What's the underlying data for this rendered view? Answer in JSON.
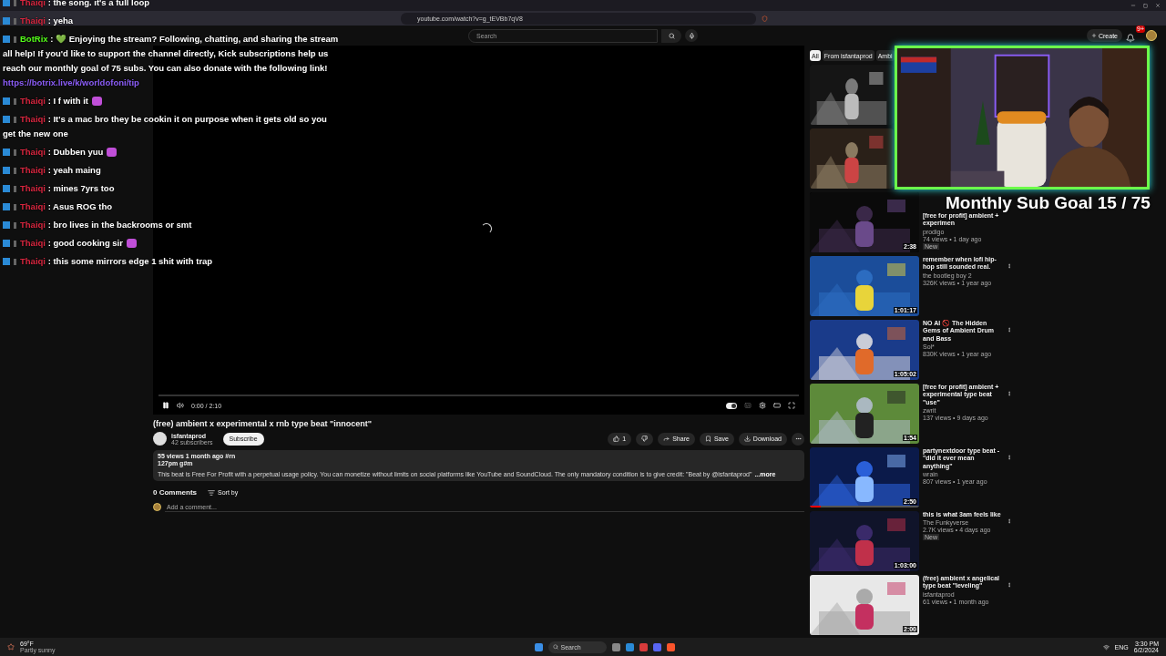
{
  "browser": {
    "url": "youtube.com/watch?v=g_tEVBb7qV8"
  },
  "header": {
    "search_placeholder": "Search",
    "create": "Create",
    "notifications": "9+"
  },
  "player": {
    "time": "0:00 / 2:10",
    "autoplay": true
  },
  "video": {
    "title": "(free) ambient x experimental x rnb type beat \"innocent\"",
    "channel": "isfantaprod",
    "subscribers": "42 subscribers",
    "subscribe": "Subscribe",
    "likes": "1",
    "actions": [
      "Share",
      "Save",
      "Download"
    ],
    "stats": "55 views  1 month ago  #rn",
    "meta": "127pm g#m",
    "description": "This beat is Free For Profit with a perpetual usage policy. You can monetize without limits on social platforms like YouTube and SoundCloud. The only mandatory condition is to give credit: \"Beat by @isfantaprod\"",
    "more": "...more"
  },
  "comments": {
    "count": "0 Comments",
    "sort": "Sort by",
    "placeholder": "Add a comment..."
  },
  "chips": [
    {
      "label": "All",
      "selected": true
    },
    {
      "label": "From isfantaprod",
      "selected": false
    },
    {
      "label": "Ambi",
      "selected": false
    }
  ],
  "recommended": [
    {
      "kind": "picture"
    },
    {
      "kind": "picture"
    },
    {
      "kind": "video",
      "title": "[free for profit] ambient + experimen",
      "channel": "prodigo",
      "stats": "74 views • 1 day ago",
      "duration": "2:38",
      "badge": "New"
    },
    {
      "kind": "video",
      "title": "remember when lofi hip-hop still sounded real.",
      "channel": "the bootleg boy 2",
      "stats": "326K views • 1 year ago",
      "duration": "1:01:17"
    },
    {
      "kind": "video",
      "title": "NO AI 🚫 The Hidden Gems of Ambient Drum and Bass",
      "channel": "Sol*",
      "stats": "830K views • 1 year ago",
      "duration": "1:05:02"
    },
    {
      "kind": "video",
      "title": "[free for profit] ambient + experimental type beat \"use\"",
      "channel": "zwrit",
      "stats": "137 views • 9 days ago",
      "duration": "1:54"
    },
    {
      "kind": "video",
      "title": "partynextdoor type beat - \"did it ever mean anything\"",
      "channel": "wrain",
      "stats": "807 views • 1 year ago",
      "duration": "2:50",
      "level": 0.1
    },
    {
      "kind": "video",
      "title": "this is what 3am feels like",
      "channel": "The Funkyverse",
      "stats": "2.7K views • 4 days ago",
      "duration": "1:03:00",
      "badge": "New"
    },
    {
      "kind": "video",
      "title": "(free) ambient x angelical type beat \"leveling\"",
      "channel": "isfantaprod",
      "stats": "61 views • 1 month ago",
      "duration": "2:00"
    }
  ],
  "chat": [
    {
      "user": "Thaiqi",
      "color": "#d8263f",
      "text": ": the song. it's a full loop",
      "emote": false
    },
    {
      "user": "Thaiqi",
      "color": "#d8263f",
      "text": ": yeha",
      "emote": false
    },
    {
      "user": "BotRix",
      "color": "#53fc18",
      "text": ": 💚 Enjoying the stream? Following, chatting, and sharing the stream all help! If you'd like to support the channel directly, Kick subscriptions help us reach our monthly goal of 75 subs. You can also donate with the following link!",
      "link": "https://botrix.live/k/worldofoni/tip",
      "emote": false
    },
    {
      "user": "Thaiqi",
      "color": "#d8263f",
      "text": ": I f with it",
      "emote": true
    },
    {
      "user": "Thaiqi",
      "color": "#d8263f",
      "text": ": It's a mac bro they be cookin it on purpose when it gets old so you get the new one",
      "emote": false
    },
    {
      "user": "Thaiqi",
      "color": "#d8263f",
      "text": ": Dubben yuu",
      "emote": true
    },
    {
      "user": "Thaiqi",
      "color": "#d8263f",
      "text": ": yeah maing",
      "emote": false
    },
    {
      "user": "Thaiqi",
      "color": "#d8263f",
      "text": ": mines 7yrs too",
      "emote": false
    },
    {
      "user": "Thaiqi",
      "color": "#d8263f",
      "text": ": Asus ROG tho",
      "emote": false
    },
    {
      "user": "Thaiqi",
      "color": "#d8263f",
      "text": ": bro lives in the backrooms or smt",
      "emote": false
    },
    {
      "user": "Thaiqi",
      "color": "#d8263f",
      "text": ": good cooking sir",
      "emote": true
    },
    {
      "user": "Thaiqi",
      "color": "#d8263f",
      "text": ": this some mirrors edge 1 shit with trap",
      "emote": false
    }
  ],
  "goal": "Monthly Sub Goal 15 / 75",
  "taskbar": {
    "temperature": "69°F",
    "weather": "Partly sunny",
    "search": "Search",
    "lang": "ENG",
    "time": "3:30 PM",
    "date": "6/2/2024"
  }
}
